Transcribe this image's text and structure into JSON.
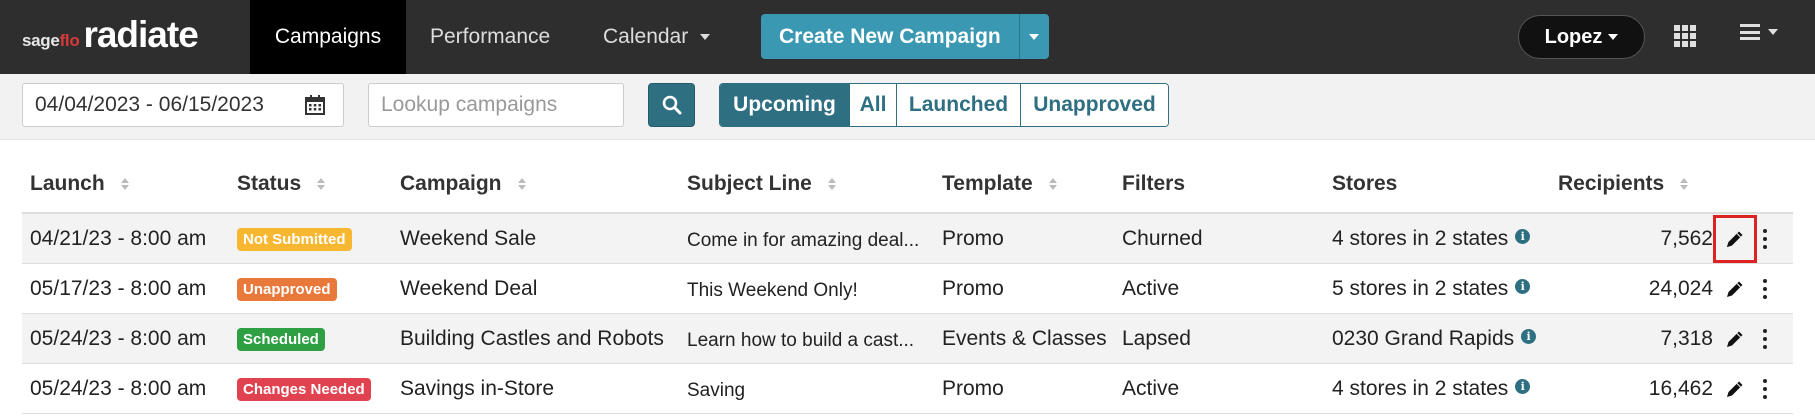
{
  "brand": {
    "small_prefix": "sage",
    "small_suffix": "flo",
    "big": "radiate"
  },
  "nav": {
    "items": [
      {
        "label": "Campaigns",
        "active": true
      },
      {
        "label": "Performance",
        "active": false
      },
      {
        "label": "Calendar",
        "active": false,
        "dropdown": true
      }
    ],
    "create_label": "Create New Campaign",
    "user_label": "Lopez"
  },
  "filters": {
    "date_range": "04/04/2023 - 06/15/2023",
    "search_placeholder": "Lookup campaigns",
    "search_value": "",
    "segments": [
      {
        "label": "Upcoming",
        "active": true
      },
      {
        "label": "All",
        "active": false
      },
      {
        "label": "Launched",
        "active": false
      },
      {
        "label": "Unapproved",
        "active": false
      }
    ]
  },
  "table": {
    "columns": [
      "Launch",
      "Status",
      "Campaign",
      "Subject Line",
      "Template",
      "Filters",
      "Stores",
      "Recipients"
    ],
    "rows": [
      {
        "launch": "04/21/23 - 8:00 am",
        "status": "Not Submitted",
        "campaign": "Weekend Sale",
        "subject": "Come in for amazing deal...",
        "template": "Promo",
        "filters": "Churned",
        "stores": "4 stores in 2 states",
        "recipients": "7,562"
      },
      {
        "launch": "05/17/23 - 8:00 am",
        "status": "Unapproved",
        "campaign": "Weekend Deal",
        "subject": "This Weekend Only!",
        "template": "Promo",
        "filters": "Active",
        "stores": "5 stores in 2 states",
        "recipients": "24,024"
      },
      {
        "launch": "05/24/23 - 8:00 am",
        "status": "Scheduled",
        "campaign": "Building Castles and Robots",
        "subject": "Learn how to build a cast...",
        "template": "Events & Classes",
        "filters": "Lapsed",
        "stores": "0230 Grand Rapids",
        "recipients": "7,318"
      },
      {
        "launch": "05/24/23 - 8:00 am",
        "status": "Changes Needed",
        "campaign": "Savings in-Store",
        "subject": "Saving",
        "template": "Promo",
        "filters": "Active",
        "stores": "4 stores in 2 states",
        "recipients": "16,462"
      }
    ]
  },
  "status_colors": {
    "Not Submitted": "#f7b731",
    "Unapproved": "#e8793a",
    "Scheduled": "#2ea043",
    "Changes Needed": "#e0434f"
  },
  "colors": {
    "nav_bg": "#2e2e2e",
    "accent": "#2f6f82",
    "create_btn": "#3b98b3"
  },
  "icons": {
    "calendar": "calendar-icon",
    "search": "search-icon",
    "sort": "sort-icon",
    "info": "info-icon",
    "edit": "pencil-icon",
    "more": "kebab-icon",
    "apps": "grid-icon",
    "menu": "hamburger-icon"
  }
}
